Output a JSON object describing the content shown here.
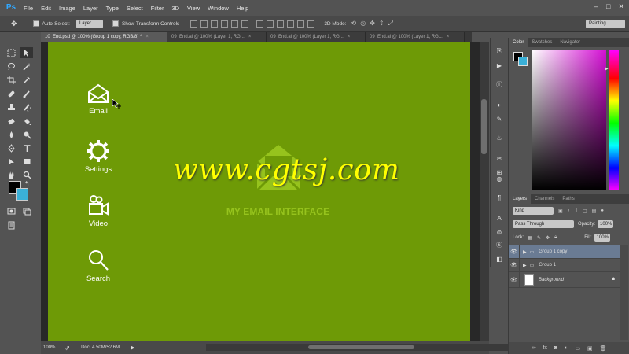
{
  "app": {
    "logo": "Ps"
  },
  "menu": [
    "File",
    "Edit",
    "Image",
    "Layer",
    "Type",
    "Select",
    "Filter",
    "3D",
    "View",
    "Window",
    "Help"
  ],
  "window_controls": [
    "–",
    "□",
    "✕"
  ],
  "options": {
    "auto_select_label": "Auto-Select:",
    "auto_select_value": "Layer",
    "transform_label": "Show Transform Controls",
    "mode_label": "3D Mode:",
    "workspace": "Painting"
  },
  "tabs": [
    {
      "label": "10_End.psd @ 100% (Group 1 copy, RGB/8) *",
      "active": true
    },
    {
      "label": "09_End.ai @ 100% (Layer 1, RG...",
      "active": false
    },
    {
      "label": "09_End.ai @ 100% (Layer 1, RG...",
      "active": false
    },
    {
      "label": "09_End.ai @ 100% (Layer 1, RG...",
      "active": false
    }
  ],
  "tab_close": "×",
  "canvas": {
    "background_color": "#6e9a06",
    "menu_items": [
      {
        "label": "Email",
        "icon": "envelope-icon"
      },
      {
        "label": "Settings",
        "icon": "gear-icon"
      },
      {
        "label": "Video",
        "icon": "video-camera-icon"
      },
      {
        "label": "Search",
        "icon": "magnifier-icon"
      }
    ],
    "title": "MY EMAIL INTERFACE",
    "watermark": "www.cgtsj.com"
  },
  "status": {
    "zoom": "100%",
    "doc": "Doc: 4.50M/52.6M"
  },
  "color_panel": {
    "tabs": [
      "Color",
      "Swatches",
      "Navigator"
    ]
  },
  "layers_panel": {
    "tabs": [
      "Layers",
      "Channels",
      "Paths"
    ],
    "kind": "Kind",
    "blend_mode": "Pass Through",
    "opacity_label": "Opacity:",
    "opacity_value": "100%",
    "lock_label": "Lock:",
    "fill_label": "Fill:",
    "fill_value": "100%",
    "layers": [
      {
        "name": "Group 1 copy",
        "selected": true
      },
      {
        "name": "Group 1",
        "selected": false
      },
      {
        "name": "Background",
        "selected": false
      }
    ]
  },
  "colors": {
    "accent_selected_layer": "#6a7b93",
    "watermark": "#ffff00",
    "subtitle": "#96c31d"
  }
}
